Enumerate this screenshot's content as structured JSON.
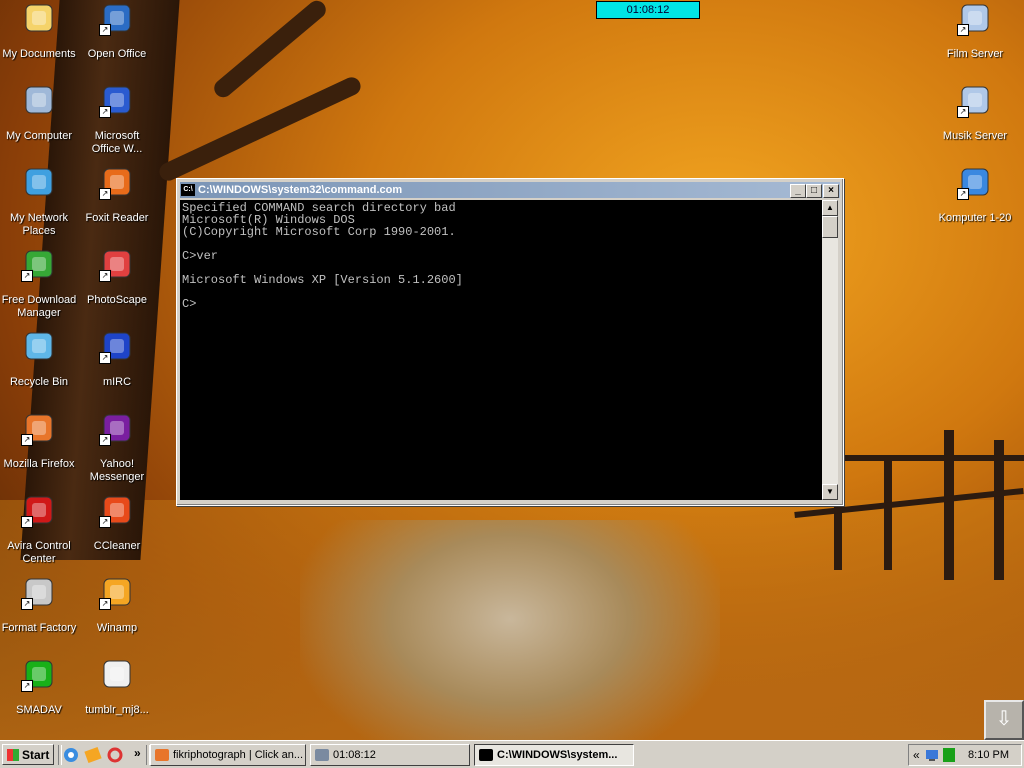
{
  "desktop_icons_left": [
    {
      "label": "My Documents",
      "icon": "folder-documents-icon",
      "shortcut": false
    },
    {
      "label": "Open Office",
      "icon": "openoffice-icon",
      "shortcut": true
    },
    {
      "label": "My Computer",
      "icon": "computer-icon",
      "shortcut": false
    },
    {
      "label": "Microsoft Office W...",
      "icon": "word-icon",
      "shortcut": true
    },
    {
      "label": "My Network Places",
      "icon": "network-places-icon",
      "shortcut": false
    },
    {
      "label": "Foxit Reader",
      "icon": "foxit-reader-icon",
      "shortcut": true
    },
    {
      "label": "Free Download Manager",
      "icon": "download-manager-icon",
      "shortcut": true
    },
    {
      "label": "PhotoScape",
      "icon": "photoscape-icon",
      "shortcut": true
    },
    {
      "label": "Recycle Bin",
      "icon": "recycle-bin-icon",
      "shortcut": false
    },
    {
      "label": "mIRC",
      "icon": "mirc-icon",
      "shortcut": true
    },
    {
      "label": "Mozilla Firefox",
      "icon": "firefox-icon",
      "shortcut": true
    },
    {
      "label": "Yahoo! Messenger",
      "icon": "yahoo-messenger-icon",
      "shortcut": true
    },
    {
      "label": "Avira Control Center",
      "icon": "avira-icon",
      "shortcut": true
    },
    {
      "label": "CCleaner",
      "icon": "ccleaner-icon",
      "shortcut": true
    },
    {
      "label": "Format Factory",
      "icon": "format-factory-icon",
      "shortcut": true
    },
    {
      "label": "Winamp",
      "icon": "winamp-icon",
      "shortcut": true
    },
    {
      "label": "SMADAV",
      "icon": "smadav-icon",
      "shortcut": true
    },
    {
      "label": "tumblr_mj8...",
      "icon": "image-file-icon",
      "shortcut": false
    }
  ],
  "desktop_icons_right": [
    {
      "label": "Film Server",
      "icon": "network-drive-icon",
      "shortcut": true
    },
    {
      "label": "Musik Server",
      "icon": "network-drive-icon",
      "shortcut": true
    },
    {
      "label": "Komputer 1-20",
      "icon": "network-computers-icon",
      "shortcut": true
    }
  ],
  "top_clock": "01:08:12",
  "console_window": {
    "title": "C:\\WINDOWS\\system32\\command.com",
    "icon_text": "C:\\",
    "lines": [
      "Specified COMMAND search directory bad",
      "Microsoft(R) Windows DOS",
      "(C)Copyright Microsoft Corp 1990-2001.",
      "",
      "C>ver",
      "",
      "Microsoft Windows XP [Version 5.1.2600]",
      "",
      "C>"
    ]
  },
  "taskbar": {
    "start_label": "Start",
    "chevron": "»",
    "buttons": [
      {
        "label": "fikriphotograph | Click an...",
        "icon": "firefox-icon",
        "active": false
      },
      {
        "label": "01:08:12",
        "icon": "clock-app-icon",
        "active": false
      },
      {
        "label": "C:\\WINDOWS\\system...",
        "icon": "console-icon",
        "active": true
      }
    ],
    "tray": {
      "expand": "«",
      "time": "8:10 PM"
    }
  },
  "colors": {
    "console_bg": "#000000",
    "console_text": "#c0c0c0",
    "titlebar_inactive": "#7b95b6",
    "top_clock_bg": "#00e5e5"
  }
}
